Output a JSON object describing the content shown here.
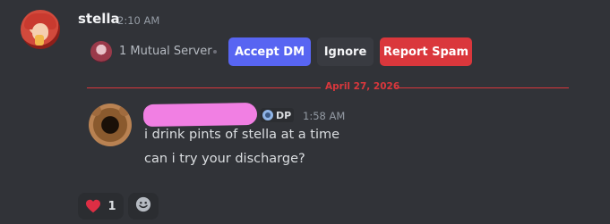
{
  "message1": {
    "username": "stella",
    "timestamp": "2:10 AM",
    "mutual_servers": "1 Mutual Server",
    "buttons": {
      "accept": "Accept DM",
      "ignore": "Ignore",
      "report": "Report Spam"
    }
  },
  "divider": {
    "date": "April 27, 2026"
  },
  "message2": {
    "tag": "DP",
    "timestamp": "1:58 AM",
    "lines": [
      "i drink pints of stella at a time",
      "can i try your discharge?"
    ]
  },
  "reactions": [
    {
      "emoji": "heart-icon",
      "count": "1"
    }
  ],
  "colors": {
    "background": "#313338",
    "accept": "#5865f2",
    "report": "#da373c",
    "divider": "#da373c",
    "redaction": "#f17fe3"
  }
}
